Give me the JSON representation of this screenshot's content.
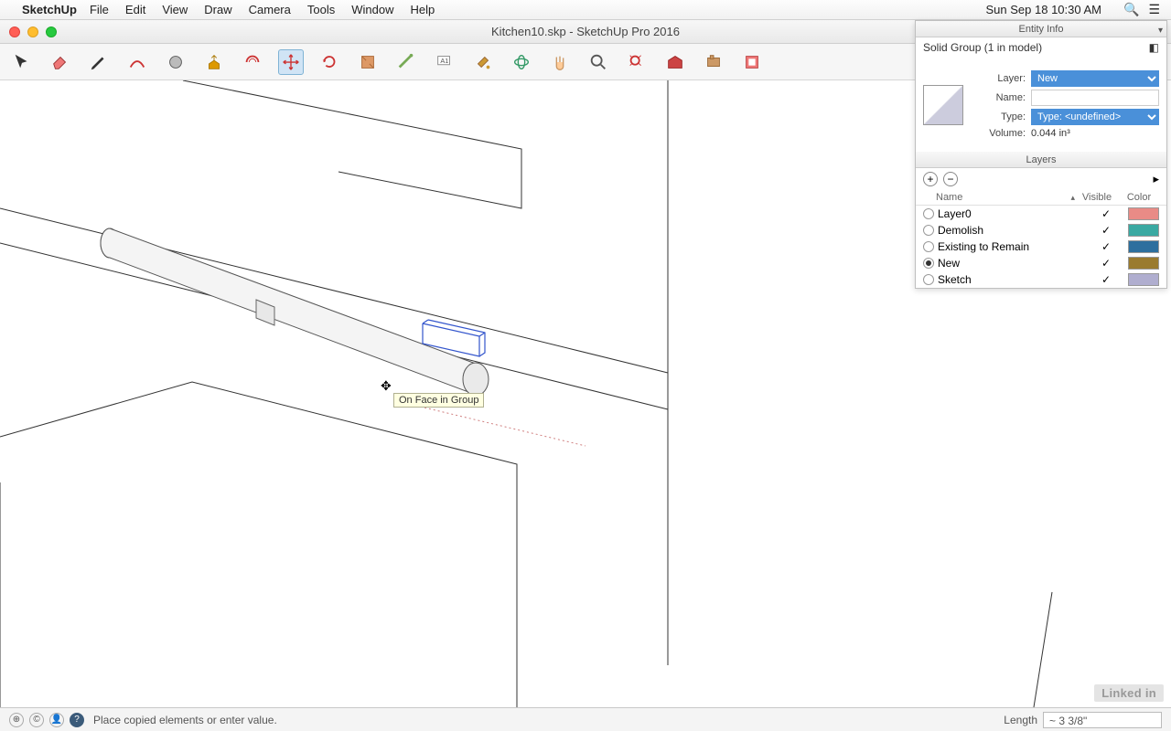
{
  "menubar": {
    "app": "SketchUp",
    "items": [
      "File",
      "Edit",
      "View",
      "Draw",
      "Camera",
      "Tools",
      "Window",
      "Help"
    ],
    "clock": "Sun Sep 18  10:30 AM"
  },
  "titlebar": {
    "title": "Kitchen10.skp - SketchUp Pro 2016"
  },
  "toolbar": {
    "tools": [
      {
        "name": "select-tool",
        "icon": "cursor"
      },
      {
        "name": "eraser-tool",
        "icon": "eraser"
      },
      {
        "name": "pencil-tool",
        "icon": "pencil"
      },
      {
        "name": "arc-tool",
        "icon": "arc"
      },
      {
        "name": "shape-tool",
        "icon": "shape"
      },
      {
        "name": "pushpull-tool",
        "icon": "pushpull"
      },
      {
        "name": "offset-tool",
        "icon": "offset"
      },
      {
        "name": "move-tool",
        "icon": "move",
        "active": true
      },
      {
        "name": "rotate-tool",
        "icon": "rotate"
      },
      {
        "name": "scale-tool",
        "icon": "scale"
      },
      {
        "name": "tape-tool",
        "icon": "tape"
      },
      {
        "name": "text-tool",
        "icon": "text"
      },
      {
        "name": "paint-tool",
        "icon": "paint"
      },
      {
        "name": "orbit-tool",
        "icon": "orbit"
      },
      {
        "name": "pan-tool",
        "icon": "pan"
      },
      {
        "name": "zoom-tool",
        "icon": "zoom"
      },
      {
        "name": "zoomextents-tool",
        "icon": "zoomext"
      },
      {
        "name": "warehouse-tool",
        "icon": "warehouse"
      },
      {
        "name": "extensions-tool",
        "icon": "ext"
      },
      {
        "name": "layout-tool",
        "icon": "layout"
      }
    ]
  },
  "viewport": {
    "tooltip": "On Face in Group"
  },
  "entity_info": {
    "panel_title": "Entity Info",
    "selection": "Solid Group (1 in model)",
    "layer_label": "Layer:",
    "layer_value": "New",
    "name_label": "Name:",
    "name_value": "",
    "type_label": "Type:",
    "type_value": "Type: <undefined>",
    "volume_label": "Volume:",
    "volume_value": "0.044 in³"
  },
  "layers_panel": {
    "title": "Layers",
    "cols": {
      "name": "Name",
      "visible": "Visible",
      "color": "Color"
    },
    "rows": [
      {
        "name": "Layer0",
        "visible": true,
        "active": false,
        "color": "#e98b86"
      },
      {
        "name": "Demolish",
        "visible": true,
        "active": false,
        "color": "#3aa9a2"
      },
      {
        "name": "Existing to Remain",
        "visible": true,
        "active": false,
        "color": "#2d6f9e"
      },
      {
        "name": "New",
        "visible": true,
        "active": true,
        "color": "#9a7b2f"
      },
      {
        "name": "Sketch",
        "visible": true,
        "active": false,
        "color": "#b0aecf"
      }
    ]
  },
  "statusbar": {
    "message": "Place copied elements or enter value.",
    "measure_label": "Length",
    "measure_value": "~ 3 3/8\""
  },
  "badge": "Linked in"
}
